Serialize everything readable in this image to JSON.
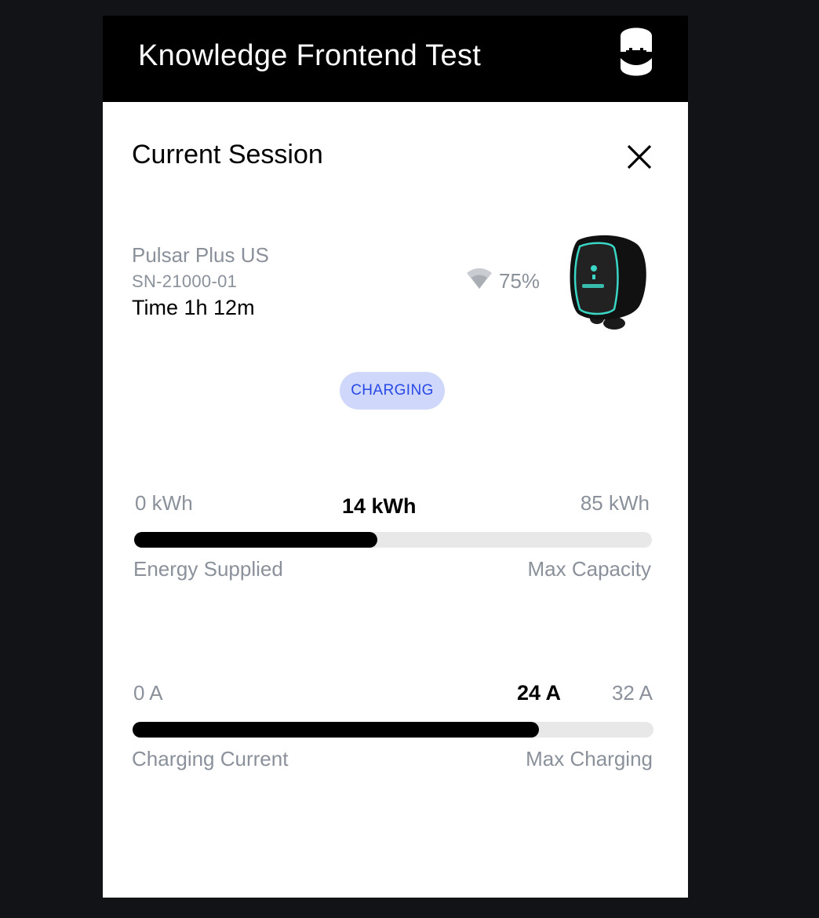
{
  "header": {
    "title": "Knowledge Frontend Test",
    "logo_icon": "wallbox-logo-icon"
  },
  "session": {
    "title": "Current Session",
    "close_icon": "close-icon",
    "charger": {
      "name": "Pulsar Plus US",
      "serial": "SN-21000-01",
      "time": "Time 1h 12m",
      "wifi_icon": "wifi-icon",
      "signal": "75%",
      "image_icon": "wallbox-charger-device"
    },
    "status": "CHARGING",
    "energy": {
      "min_label": "0 kWh",
      "current_label": "14 kWh",
      "max_label": "85 kWh",
      "left_caption": "Energy Supplied",
      "right_caption": "Max Capacity",
      "progress": 0.47
    },
    "current": {
      "min_label": "0 A",
      "current_label": "24 A",
      "max_label": "32 A",
      "left_caption": "Charging Current",
      "right_caption": "Max Charging",
      "progress": 0.78
    }
  },
  "colors": {
    "page_background": "#121317",
    "header_background": "#000000",
    "muted_text": "#8a919a",
    "badge_background": "#cfd8fb",
    "badge_text": "#2848e6",
    "device_accent": "#3ad6c6"
  }
}
